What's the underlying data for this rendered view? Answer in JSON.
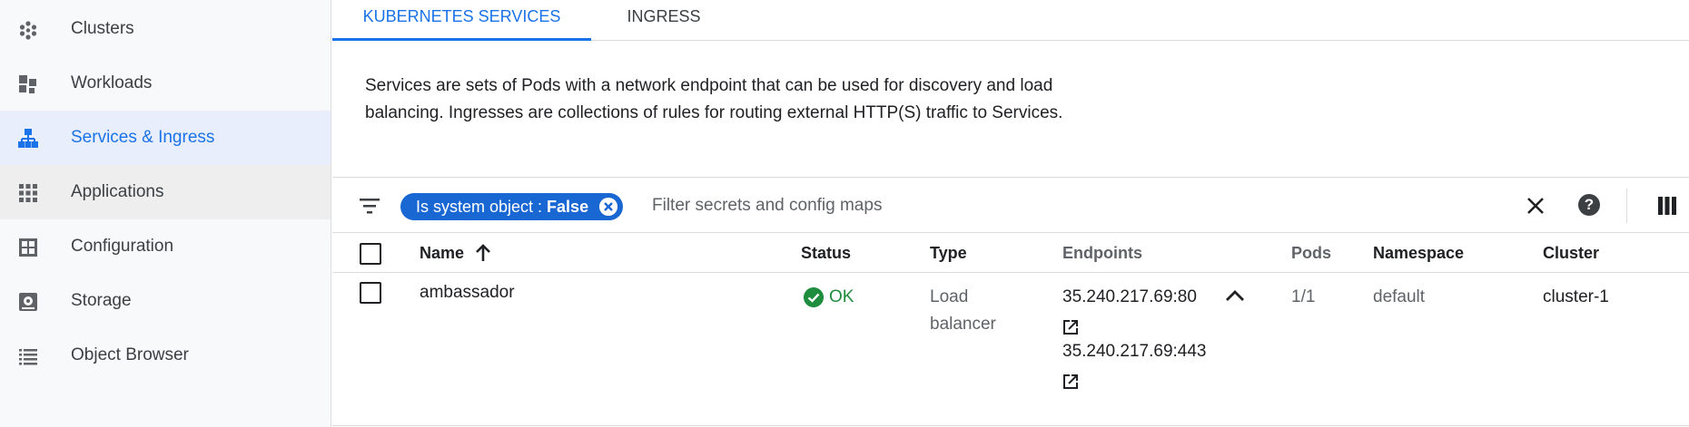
{
  "sidebar": {
    "items": [
      {
        "label": "Clusters",
        "icon": "clusters-icon"
      },
      {
        "label": "Workloads",
        "icon": "workloads-icon"
      },
      {
        "label": "Services & Ingress",
        "icon": "services-icon",
        "active": true
      },
      {
        "label": "Applications",
        "icon": "apps-grid-icon"
      },
      {
        "label": "Configuration",
        "icon": "configuration-icon"
      },
      {
        "label": "Storage",
        "icon": "storage-icon"
      },
      {
        "label": "Object Browser",
        "icon": "list-icon"
      }
    ]
  },
  "tabs": [
    {
      "label": "KUBERNETES SERVICES",
      "active": true
    },
    {
      "label": "INGRESS",
      "active": false
    }
  ],
  "description": "Services are sets of Pods with a network endpoint that can be used for discovery and load balancing. Ingresses are collections of rules for routing external HTTP(S) traffic to Services.",
  "filter": {
    "chip_key": "Is system object : ",
    "chip_value": "False",
    "placeholder": "Filter secrets and config maps"
  },
  "table": {
    "headers": {
      "name": "Name",
      "status": "Status",
      "type": "Type",
      "endpoints": "Endpoints",
      "pods": "Pods",
      "namespace": "Namespace",
      "cluster": "Cluster"
    },
    "rows": [
      {
        "name": "ambassador",
        "status": "OK",
        "type_line1": "Load",
        "type_line2": "balancer",
        "endpoint1": "35.240.217.69:80",
        "endpoint2": "35.240.217.69:443",
        "pods": "1/1",
        "namespace": "default",
        "cluster": "cluster-1"
      }
    ]
  },
  "colors": {
    "accent": "#1a73e8",
    "chip": "#1967d2",
    "ok": "#1e8e3e",
    "active_nav_bg": "#e8eefb"
  }
}
